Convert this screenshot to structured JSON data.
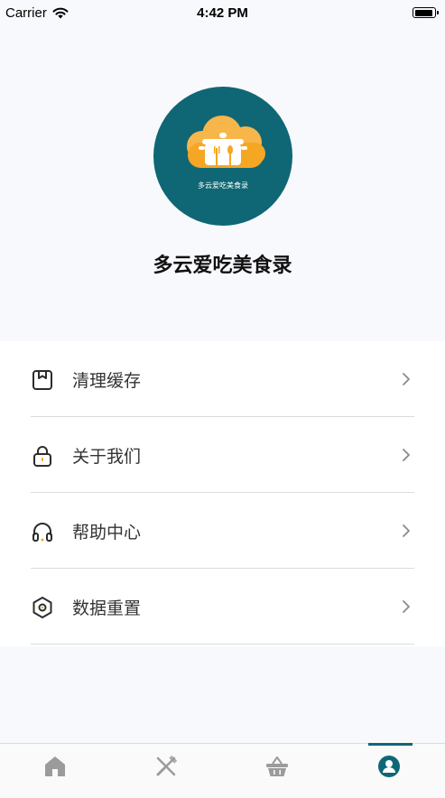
{
  "status_bar": {
    "carrier": "Carrier",
    "time": "4:42 PM"
  },
  "profile": {
    "logo_caption": "多云爱吃美食录",
    "title": "多云爱吃美食录"
  },
  "menu": {
    "items": [
      {
        "label": "清理缓存",
        "icon": "package-box-icon"
      },
      {
        "label": "关于我们",
        "icon": "lock-icon"
      },
      {
        "label": "帮助中心",
        "icon": "headphones-icon"
      },
      {
        "label": "数据重置",
        "icon": "hexagon-settings-icon"
      }
    ]
  },
  "tab_bar": {
    "tabs": [
      {
        "icon": "home-icon",
        "active": false
      },
      {
        "icon": "fork-knife-icon",
        "active": false
      },
      {
        "icon": "basket-icon",
        "active": false
      },
      {
        "icon": "user-circle-icon",
        "active": true
      }
    ]
  },
  "colors": {
    "accent": "#0f6775",
    "logo_orange": "#f5a623",
    "icon_gray": "#9b9b9b"
  }
}
